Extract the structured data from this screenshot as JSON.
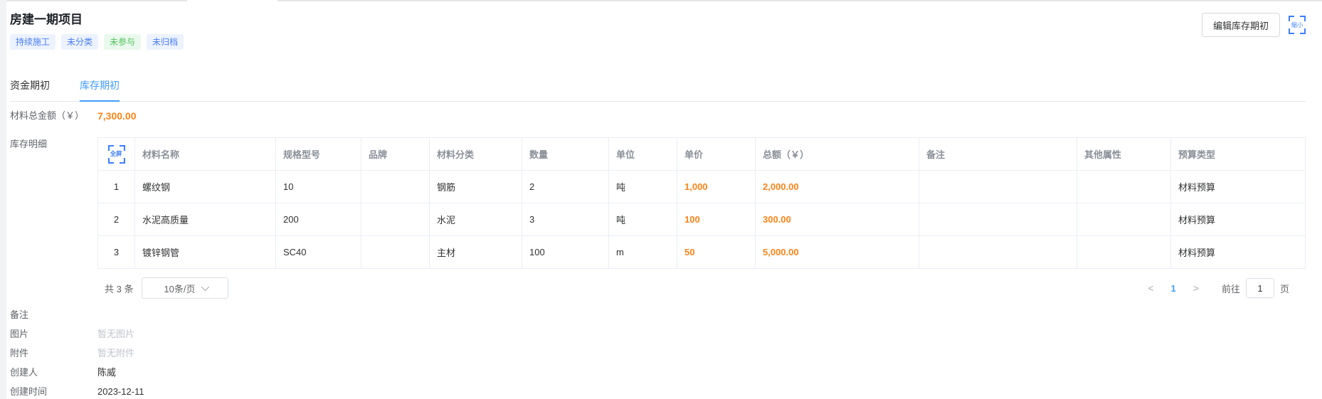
{
  "colors": {
    "accent_blue": "#409eff",
    "icon_blue": "#3d7eff",
    "orange": "#fa8316",
    "tag_green": "#53c25c"
  },
  "header": {
    "title": "房建一期项目",
    "tags": [
      {
        "label": "持续施工",
        "type": "blue"
      },
      {
        "label": "未分类",
        "type": "blue"
      },
      {
        "label": "未参与",
        "type": "green"
      },
      {
        "label": "未归档",
        "type": "blue"
      }
    ],
    "edit_button": "编辑库存期初",
    "collapse_icon_label": "缩小"
  },
  "tabs": [
    {
      "label": "资金期初",
      "active": false
    },
    {
      "label": "库存期初",
      "active": true
    }
  ],
  "summary": {
    "label": "材料总金额（￥）",
    "value": "7,300.00"
  },
  "inventory": {
    "label": "库存明细",
    "fullscreen_icon_label": "全屏",
    "columns": [
      "材料名称",
      "规格型号",
      "品牌",
      "材料分类",
      "数量",
      "单位",
      "单价",
      "总额（￥）",
      "备注",
      "其他属性",
      "预算类型"
    ],
    "rows": [
      {
        "index": "1",
        "name": "螺纹钢",
        "spec": "10",
        "brand": "",
        "category": "钢筋",
        "qty": "2",
        "unit": "吨",
        "price": "1,000",
        "total": "2,000.00",
        "remark": "",
        "other": "",
        "budget": "材料预算"
      },
      {
        "index": "2",
        "name": "水泥高质量",
        "spec": "200",
        "brand": "",
        "category": "水泥",
        "qty": "3",
        "unit": "吨",
        "price": "100",
        "total": "300.00",
        "remark": "",
        "other": "",
        "budget": "材料预算"
      },
      {
        "index": "3",
        "name": "镀锌钢管",
        "spec": "SC40",
        "brand": "",
        "category": "主材",
        "qty": "100",
        "unit": "m",
        "price": "50",
        "total": "5,000.00",
        "remark": "",
        "other": "",
        "budget": "材料预算"
      }
    ],
    "pagination": {
      "total_text": "共 3 条",
      "page_size": "10条/页",
      "prev": "<",
      "current_page": "1",
      "next": ">",
      "goto_label": "前往",
      "goto_value": "1",
      "page_suffix": "页"
    }
  },
  "details": [
    {
      "label": "备注",
      "value": "",
      "muted": false
    },
    {
      "label": "图片",
      "value": "暂无图片",
      "muted": true
    },
    {
      "label": "附件",
      "value": "暂无附件",
      "muted": true
    },
    {
      "label": "创建人",
      "value": "陈威",
      "muted": false
    },
    {
      "label": "创建时间",
      "value": "2023-12-11",
      "muted": false
    }
  ]
}
